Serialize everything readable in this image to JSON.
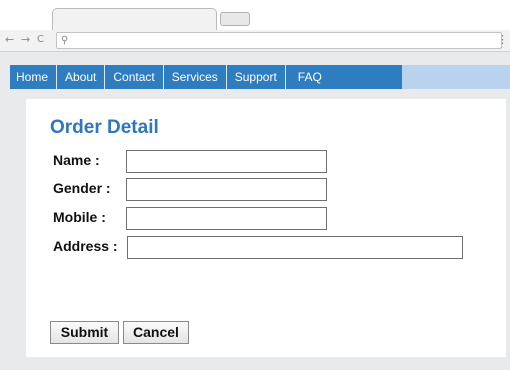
{
  "browser": {
    "nav_back": "←",
    "nav_forward": "→",
    "nav_reload": "C",
    "search_icon": "⚲",
    "menu": "⋮"
  },
  "nav": {
    "items": [
      "Home",
      "About",
      "Contact",
      "Services",
      "Support",
      "FAQ"
    ]
  },
  "form": {
    "title": "Order Detail",
    "fields": [
      {
        "label": "Name :",
        "value": ""
      },
      {
        "label": "Gender :",
        "value": ""
      },
      {
        "label": "Mobile :",
        "value": ""
      },
      {
        "label": "Address :",
        "value": ""
      }
    ],
    "submit_label": "Submit",
    "cancel_label": "Cancel"
  },
  "colors": {
    "nav_bg": "#2f7dc1",
    "nav_strip": "#b9d3ee",
    "title": "#2f77bd",
    "page_bg": "#e9eaec"
  }
}
